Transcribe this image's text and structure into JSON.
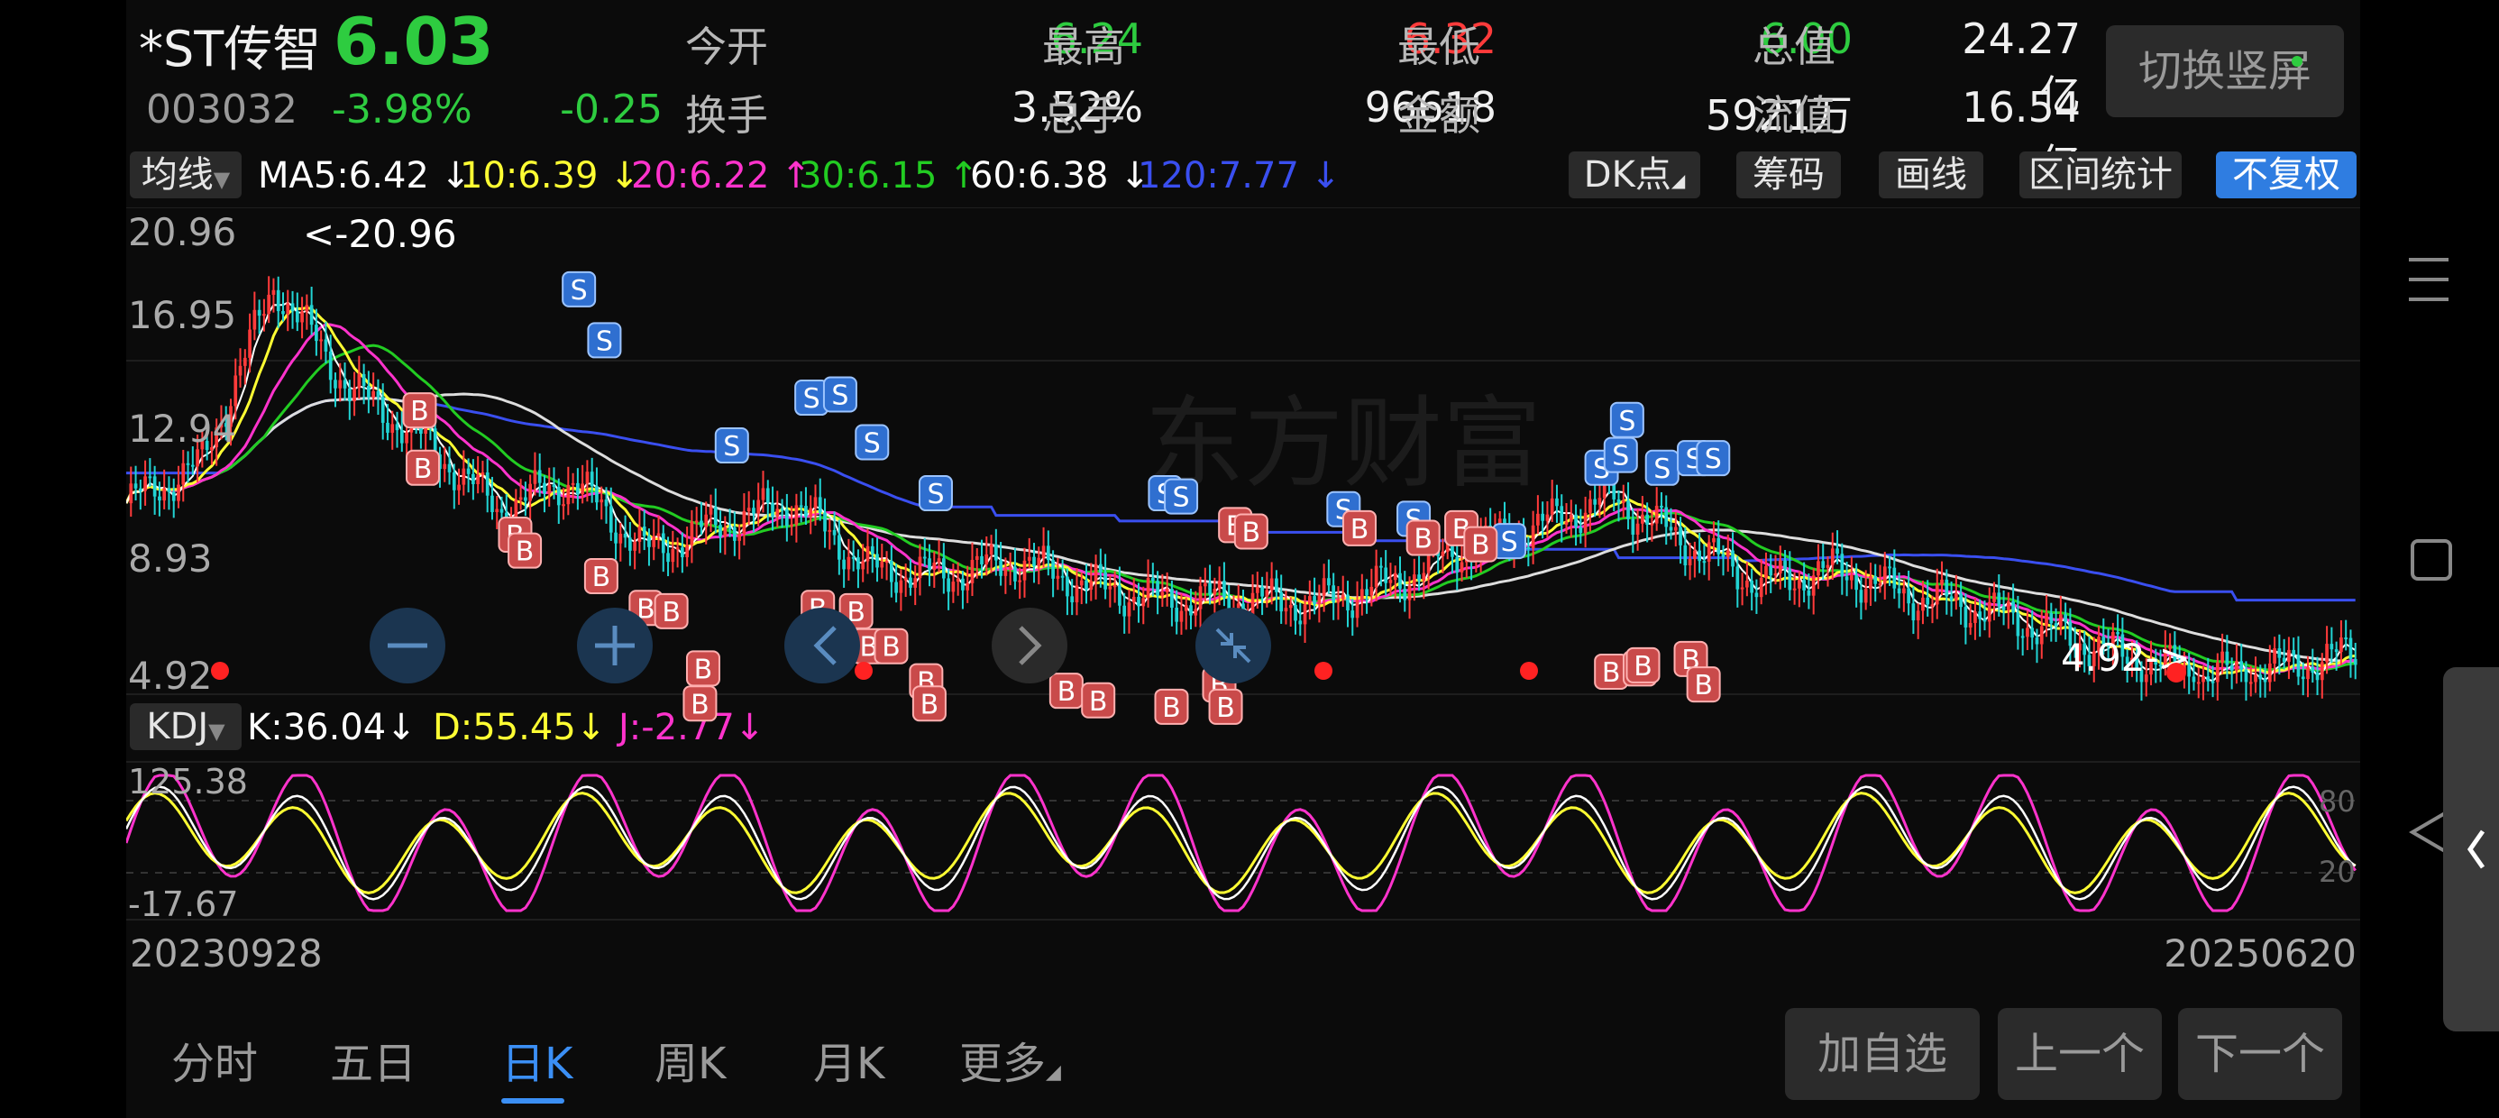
{
  "header": {
    "stock_name": "*ST传智",
    "price": "6.03",
    "code": "003032",
    "change_pct": "-3.98%",
    "change": "-0.25",
    "stats": [
      {
        "label": "今开",
        "value": "6.24",
        "color": "green"
      },
      {
        "label": "最高",
        "value": "6.32",
        "color": "red"
      },
      {
        "label": "最低",
        "value": "6.00",
        "color": "green"
      },
      {
        "label": "总值",
        "value": "24.27亿",
        "color": "white"
      },
      {
        "label": "换手",
        "value": "3.52%",
        "color": "white"
      },
      {
        "label": "总手",
        "value": "96618",
        "color": "white"
      },
      {
        "label": "金额",
        "value": "5921万",
        "color": "white"
      },
      {
        "label": "流值",
        "value": "16.54亿",
        "color": "white"
      }
    ],
    "switch_button": "切换竖屏"
  },
  "ma_bar": {
    "dropdown": "均线",
    "ma5": "MA5:6.42",
    "ma10": "10:6.39",
    "ma20": "20:6.22",
    "ma30": "30:6.15",
    "ma60": "60:6.38",
    "ma120": "120:7.77",
    "buttons": [
      "DK点",
      "筹码",
      "画线",
      "区间统计"
    ],
    "adjust": "不复权"
  },
  "price_axis": [
    "20.96",
    "16.95",
    "12.94",
    "8.93",
    "4.92"
  ],
  "annotations": {
    "high": "<-20.96",
    "low": "4.92->"
  },
  "kdj_bar": {
    "dropdown": "KDJ",
    "k": "K:36.04",
    "d": "D:55.45",
    "j": "J:-2.77"
  },
  "kdj_axis": {
    "top": "125.38",
    "bottom": "-17.67",
    "r80": "80",
    "r20": "20"
  },
  "dates": {
    "start": "20230928",
    "end": "20250620"
  },
  "signals": {
    "buy": "B",
    "sell": "S"
  },
  "watermark": "东方财富",
  "bottom_tabs": [
    "分时",
    "五日",
    "日K",
    "周K",
    "月K",
    "更多"
  ],
  "bottom_buttons": [
    "加自选",
    "上一个",
    "下一个"
  ],
  "colors": {
    "up": "#ff3b3b",
    "down": "#2ecc40",
    "ma5": "#ffffff",
    "ma10": "#ffff33",
    "ma20": "#ff33cc",
    "ma30": "#22cc22",
    "ma60": "#dddddd",
    "ma120": "#3a4ff0",
    "accent": "#3b8ff5"
  },
  "chart_data": {
    "type": "line",
    "price_range": [
      4.92,
      20.96
    ],
    "price_series": {
      "name_ma120": "120",
      "ma120": [
        12.5,
        12.2,
        12.0,
        11.9,
        11.8,
        11.6,
        11.3,
        11.0,
        10.8,
        10.4,
        10.1,
        9.8,
        9.5,
        9.2,
        8.9,
        8.6,
        8.3,
        8.0,
        7.8
      ],
      "close": [
        11.2,
        12.5,
        18.8,
        15.2,
        13.4,
        11.0,
        12.0,
        9.5,
        10.5,
        11.2,
        8.9,
        8.7,
        9.2,
        8.3,
        7.8,
        7.9,
        7.7,
        8.4,
        9.6,
        10.4,
        11.4,
        9.8,
        8.4,
        8.9,
        8.0,
        7.5,
        6.7,
        5.8,
        5.2,
        5.5,
        6.0
      ]
    }
  }
}
